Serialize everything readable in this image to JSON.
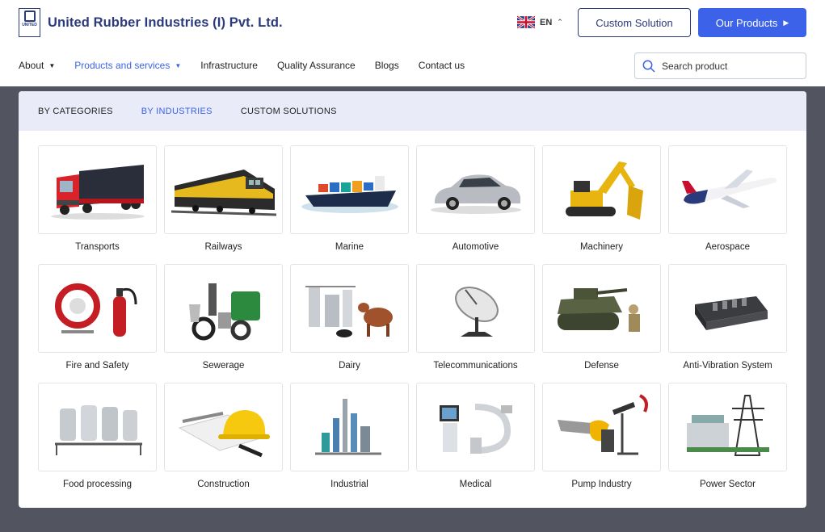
{
  "header": {
    "logo_text": "UNITED",
    "company_name": "United Rubber Industries (I) Pvt. Ltd.",
    "language": "EN",
    "custom_solution_label": "Custom Solution",
    "our_products_label": "Our Products"
  },
  "nav": {
    "items": [
      {
        "label": "About"
      },
      {
        "label": "Products and services"
      },
      {
        "label": "Infrastructure"
      },
      {
        "label": "Quality Assurance"
      },
      {
        "label": "Blogs"
      },
      {
        "label": "Contact us"
      }
    ]
  },
  "search": {
    "placeholder": "Search product"
  },
  "tabs": [
    {
      "label": "BY CATEGORIES"
    },
    {
      "label": "BY INDUSTRIES"
    },
    {
      "label": "CUSTOM SOLUTIONS"
    }
  ],
  "industries": [
    {
      "label": "Transports"
    },
    {
      "label": "Railways"
    },
    {
      "label": "Marine"
    },
    {
      "label": "Automotive"
    },
    {
      "label": "Machinery"
    },
    {
      "label": "Aerospace"
    },
    {
      "label": "Fire and Safety"
    },
    {
      "label": "Sewerage"
    },
    {
      "label": "Dairy"
    },
    {
      "label": "Telecommunications"
    },
    {
      "label": "Defense"
    },
    {
      "label": "Anti-Vibration System"
    },
    {
      "label": "Food processing"
    },
    {
      "label": "Construction"
    },
    {
      "label": "Industrial"
    },
    {
      "label": "Medical"
    },
    {
      "label": "Pump Industry"
    },
    {
      "label": "Power Sector"
    }
  ],
  "colors": {
    "brand": "#2a3a7a",
    "accent": "#3b62e8",
    "overlay": "#52555f",
    "tab_bar": "#e9ecf8"
  }
}
